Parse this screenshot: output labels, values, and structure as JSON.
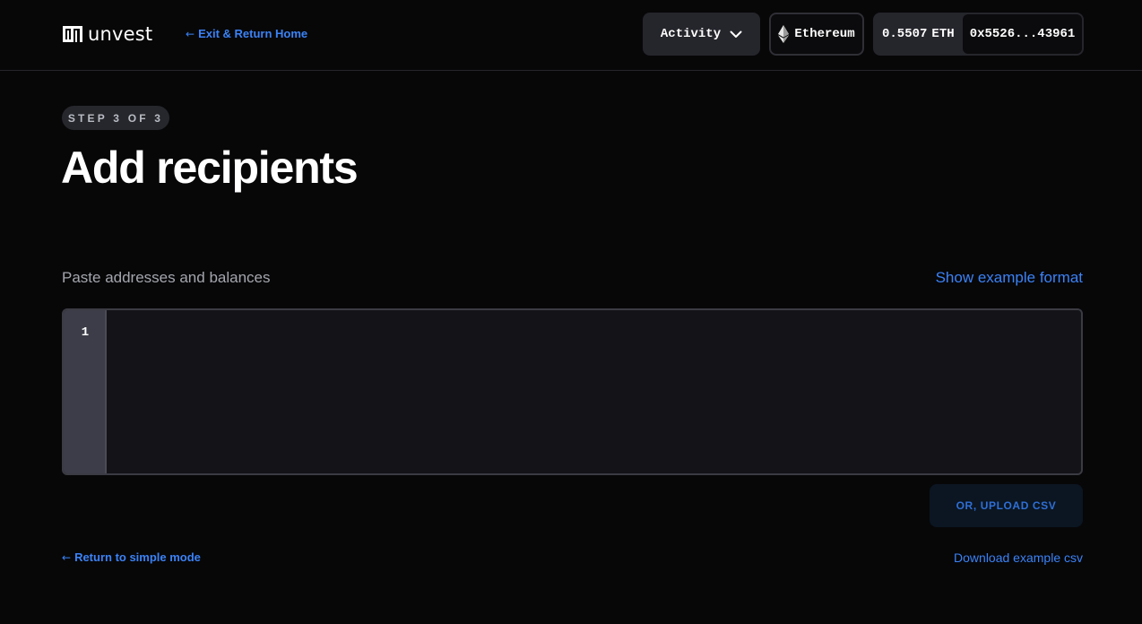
{
  "header": {
    "logo_text": "unvest",
    "exit_link": "Exit & Return Home",
    "activity_label": "Activity",
    "network_label": "Ethereum",
    "balance_value": "0.5507",
    "balance_unit": "ETH",
    "wallet_address": "0x5526...43961"
  },
  "main": {
    "step_label": "STEP 3 OF 3",
    "title": "Add recipients",
    "paste_label": "Paste addresses and balances",
    "show_example": "Show example format",
    "editor": {
      "line_numbers": [
        "1"
      ],
      "value": ""
    },
    "upload_button": "OR, UPLOAD CSV",
    "return_simple": "Return to simple mode",
    "download_csv": "Download example csv"
  },
  "colors": {
    "background": "#070708",
    "accent": "#3b82f6",
    "button_dark": "#25252c",
    "badge": "#26272c"
  },
  "icons": {
    "logo": "unvest-logo-icon",
    "back": "arrow-left-icon",
    "dropdown": "chevron-down-icon",
    "network": "ethereum-icon"
  }
}
